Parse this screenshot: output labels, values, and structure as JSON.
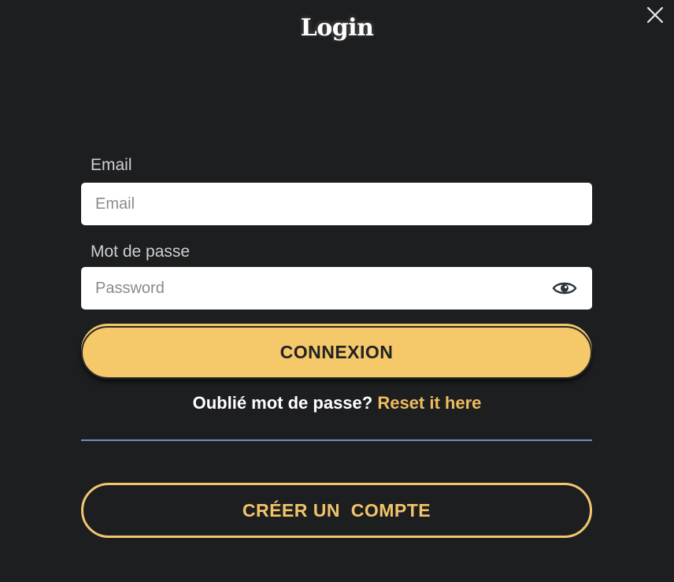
{
  "modal": {
    "title": "Login",
    "close_icon": "close-icon"
  },
  "form": {
    "email": {
      "label": "Email",
      "placeholder": "Email",
      "value": ""
    },
    "password": {
      "label": "Mot de passe",
      "placeholder": "Password",
      "value": "",
      "toggle_icon": "eye-icon"
    },
    "submit_label": "CONNEXION",
    "forgot_text": "Oublié mot de passe?",
    "reset_link": "Reset it here",
    "create_account_label": "CRÉER UN  COMPTE"
  },
  "colors": {
    "background": "#1d1e20",
    "accent": "#f5c86a",
    "link": "#efbc5f",
    "divider": "#6e8fc2",
    "input_bg": "#ffffff"
  }
}
